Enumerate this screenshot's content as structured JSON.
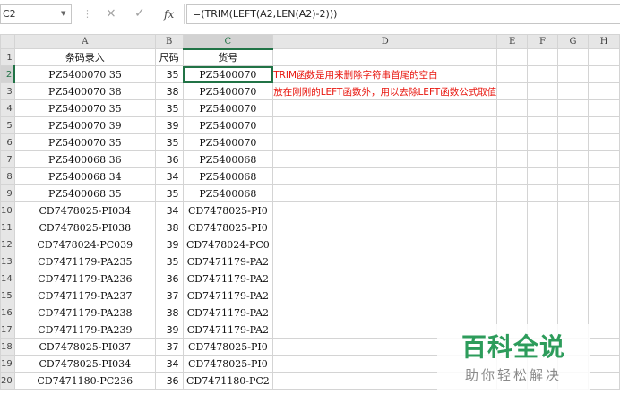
{
  "formula_bar": {
    "name_box": "C2",
    "cancel_icon": "×",
    "confirm_icon": "✓",
    "fx_label": "fx",
    "formula": "=(TRIM(LEFT(A2,LEN(A2)-2)))"
  },
  "columns": [
    "A",
    "B",
    "C",
    "D",
    "E",
    "F",
    "G",
    "H"
  ],
  "header_row": {
    "row_label": "1",
    "a": "条码录入",
    "b": "尺码",
    "c": "货号"
  },
  "rows": [
    {
      "n": "2",
      "a": "PZ5400070 35",
      "b": "35",
      "c": "PZ5400070"
    },
    {
      "n": "3",
      "a": "PZ5400070 38",
      "b": "38",
      "c": "PZ5400070"
    },
    {
      "n": "4",
      "a": "PZ5400070 35",
      "b": "35",
      "c": "PZ5400070"
    },
    {
      "n": "5",
      "a": "PZ5400070 39",
      "b": "39",
      "c": "PZ5400070"
    },
    {
      "n": "6",
      "a": "PZ5400070 35",
      "b": "35",
      "c": "PZ5400070"
    },
    {
      "n": "7",
      "a": "PZ5400068 36",
      "b": "36",
      "c": "PZ5400068"
    },
    {
      "n": "8",
      "a": "PZ5400068 34",
      "b": "34",
      "c": "PZ5400068"
    },
    {
      "n": "9",
      "a": "PZ5400068 35",
      "b": "35",
      "c": "PZ5400068"
    },
    {
      "n": "10",
      "a": "CD7478025-PI034",
      "b": "34",
      "c": "CD7478025-PI0"
    },
    {
      "n": "11",
      "a": "CD7478025-PI038",
      "b": "38",
      "c": "CD7478025-PI0"
    },
    {
      "n": "12",
      "a": "CD7478024-PC039",
      "b": "39",
      "c": "CD7478024-PC0"
    },
    {
      "n": "13",
      "a": "CD7471179-PA235",
      "b": "35",
      "c": "CD7471179-PA2"
    },
    {
      "n": "14",
      "a": "CD7471179-PA236",
      "b": "36",
      "c": "CD7471179-PA2"
    },
    {
      "n": "15",
      "a": "CD7471179-PA237",
      "b": "37",
      "c": "CD7471179-PA2"
    },
    {
      "n": "16",
      "a": "CD7471179-PA238",
      "b": "38",
      "c": "CD7471179-PA2"
    },
    {
      "n": "17",
      "a": "CD7471179-PA239",
      "b": "39",
      "c": "CD7471179-PA2"
    },
    {
      "n": "18",
      "a": "CD7478025-PI037",
      "b": "37",
      "c": "CD7478025-PI0"
    },
    {
      "n": "19",
      "a": "CD7478025-PI034",
      "b": "34",
      "c": "CD7478025-PI0"
    },
    {
      "n": "20",
      "a": "CD7471180-PC236",
      "b": "36",
      "c": "CD7471180-PC2"
    }
  ],
  "notes": {
    "line1": "TRIM函数是用来删除字符串首尾的空白",
    "line2": "放在刚刚的LEFT函数外，用以去除LEFT函数公式取值"
  },
  "watermark": {
    "title": "百科全说",
    "subtitle": "助你轻松解决"
  },
  "colors": {
    "accent": "#217346",
    "note_red": "#e8170f",
    "watermark_green": "#2d9c5b"
  }
}
